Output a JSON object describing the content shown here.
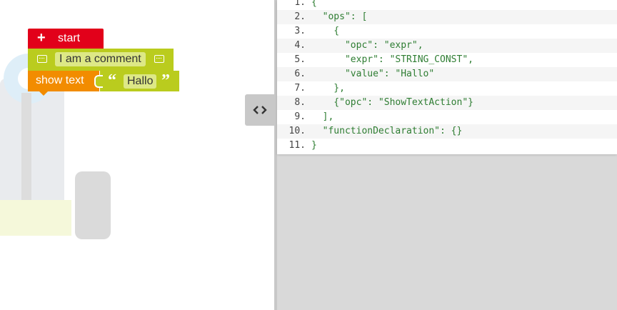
{
  "blocks": {
    "start": {
      "label": "start",
      "icon": "plus-icon"
    },
    "comment": {
      "text": "I am a comment",
      "icon": "comment-icon"
    },
    "show_text": {
      "label": "show text"
    },
    "string": {
      "value": "Hallo",
      "open_quote": "“",
      "close_quote": "”"
    }
  },
  "toggle": {
    "icon": "code-toggle-icon"
  },
  "code": {
    "lines": [
      {
        "n": "1.",
        "text": "{"
      },
      {
        "n": "2.",
        "text": "  \"ops\": ["
      },
      {
        "n": "3.",
        "text": "    {"
      },
      {
        "n": "4.",
        "text": "      \"opc\": \"expr\","
      },
      {
        "n": "5.",
        "text": "      \"expr\": \"STRING_CONST\","
      },
      {
        "n": "6.",
        "text": "      \"value\": \"Hallo\""
      },
      {
        "n": "7.",
        "text": "    },"
      },
      {
        "n": "8.",
        "text": "    {\"opc\": \"ShowTextAction\"}"
      },
      {
        "n": "9.",
        "text": "  ],"
      },
      {
        "n": "10.",
        "text": "  \"functionDeclaration\": {}"
      },
      {
        "n": "11.",
        "text": "}"
      }
    ]
  },
  "colors": {
    "start_block": "#e2001a",
    "comment_block": "#bacc1e",
    "action_block": "#f28c00",
    "code_text": "#2e7d32",
    "panel_bg": "#d9d9d9"
  }
}
